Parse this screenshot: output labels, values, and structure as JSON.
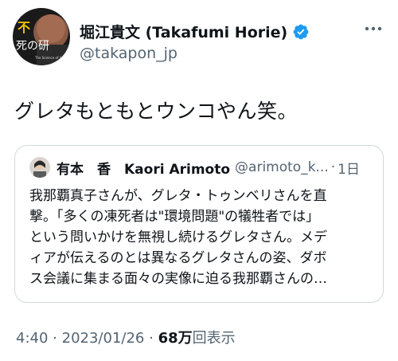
{
  "author": {
    "display_name": "堀江貴文 (Takafumi Horie)",
    "handle": "@takapon_jp",
    "avatar_text": "不死の研究",
    "avatar_caption": "The Science of Immortality"
  },
  "tweet": {
    "text": "グレタもともとウンコやん笑。"
  },
  "quoted_tweet": {
    "display_name": "有本　香　Kaori Arimoto",
    "handle": "@arimoto_k...",
    "separator": "·",
    "date": "1日",
    "lines": [
      "我那覇真子さんが、グレタ・トゥンベリさんを直",
      "撃。「多くの凍死者は\"環境問題\"の犠牲者では」",
      "という問いかけを無視し続けるグレタさん。メデ",
      "ィアが伝えるのとは異なるグレタさんの姿、ダボ",
      "ス会議に集まる面々の実像に迫る我那覇さんの…"
    ]
  },
  "meta": {
    "time": "4:40",
    "separator": "·",
    "date": "2023/01/26",
    "separator2": "·",
    "views_count": "68万",
    "views_label": "回表示"
  },
  "colors": {
    "text_primary": "#0f1419",
    "text_secondary": "#536471",
    "verified_blue": "#1d9bf0",
    "border": "#cfd9de"
  },
  "icons": {
    "verified": "verified-badge-icon",
    "more": "more-options-icon"
  }
}
